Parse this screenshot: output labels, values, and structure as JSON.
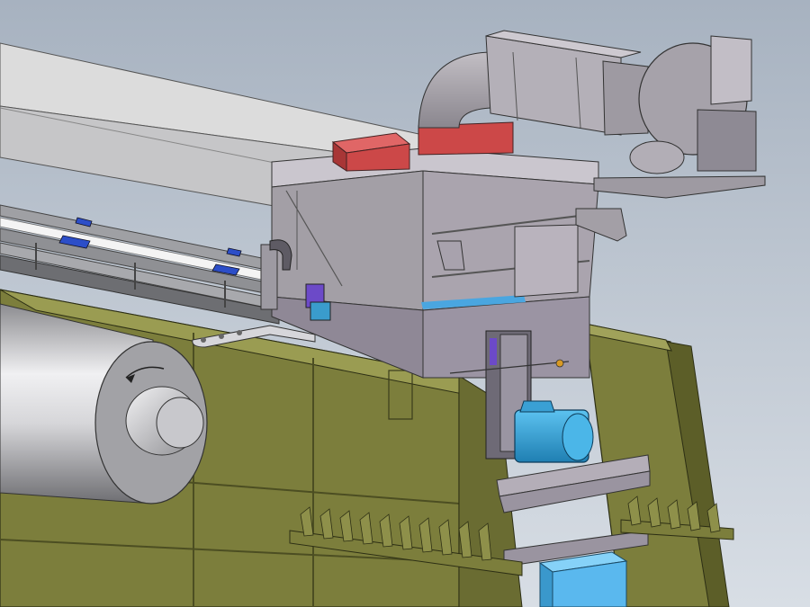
{
  "viewport": {
    "kind": "3d-cad-model-view",
    "background_top": "#a7b2c0",
    "background_bottom": "#d8dee5"
  },
  "colors": {
    "frame": "#7c7e3c",
    "frame_light": "#9a9c52",
    "frame_dark": "#4c4e22",
    "roll": "#b6b6b9",
    "hood": "#aaa4ae",
    "hood_shade": "#8e879a",
    "duct": "#a4a0a6",
    "motor": "#36a4d6",
    "box": "#5ab8ee",
    "red_part": "#cc4848",
    "blue_clip": "#2c4ec8"
  },
  "icons": [
    "rotation-direction-arrow-icon"
  ]
}
